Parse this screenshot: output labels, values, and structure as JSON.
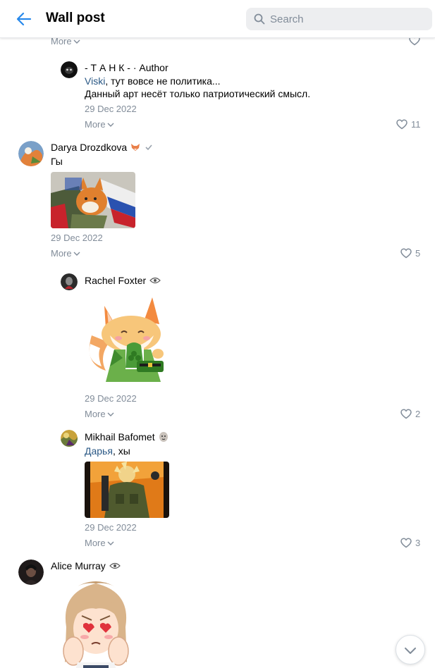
{
  "header": {
    "title": "Wall post",
    "search_placeholder": "Search"
  },
  "top_comment": {
    "more_label": "More"
  },
  "comments": [
    {
      "author": "- Т А Н К - ·",
      "author_badge": "Author",
      "reply_to": "Viski",
      "text_rest": ", тут вовсе не политика...",
      "text_line2": "Данный арт несёт только патриотический смысл.",
      "date": "29 Dec 2022",
      "more_label": "More",
      "likes": "11"
    },
    {
      "author": "Darya Drozdkova",
      "text": "Гы",
      "date": "29 Dec 2022",
      "more_label": "More",
      "likes": "5"
    },
    {
      "author": "Rachel Foxter",
      "date": "29 Dec 2022",
      "more_label": "More",
      "likes": "2"
    },
    {
      "author": "Mikhail Bafomet",
      "reply_to": "Дарья",
      "text_rest": ", хы",
      "date": "29 Dec 2022",
      "more_label": "More",
      "likes": "3"
    },
    {
      "author": "Alice Murray"
    }
  ],
  "colors": {
    "accent": "#2a5885",
    "back_arrow": "#2688eb",
    "meta": "#818c99"
  }
}
